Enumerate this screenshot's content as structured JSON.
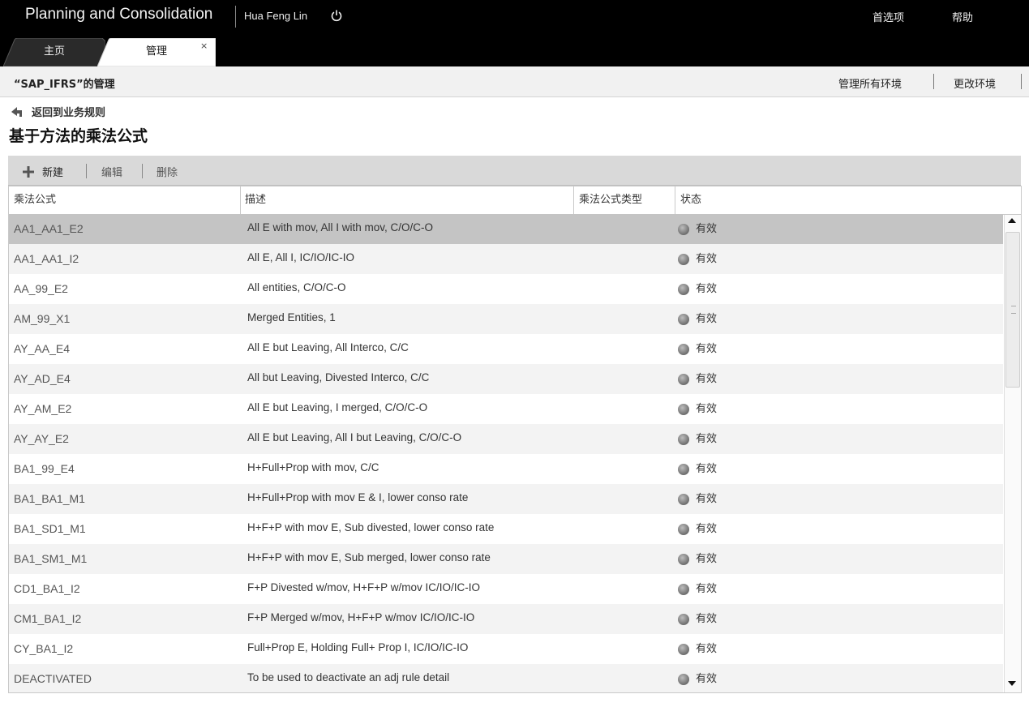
{
  "header": {
    "app_title": "Planning and Consolidation",
    "user_name": "Hua Feng Lin",
    "preferences": "首选项",
    "help": "帮助"
  },
  "tabs": [
    {
      "label": "主页",
      "active": false
    },
    {
      "label": "管理",
      "active": true
    }
  ],
  "tab_close": "×",
  "subheader": {
    "env_title": "“SAP_IFRS”的管理",
    "manage_envs": "管理所有环境",
    "change_env": "更改环境"
  },
  "back_link": "返回到业务规则",
  "page_title": "基于方法的乘法公式",
  "toolbar": {
    "new": "新建",
    "edit": "编辑",
    "delete": "删除"
  },
  "table": {
    "columns": [
      "乘法公式",
      "描述",
      "乘法公式类型",
      "状态"
    ],
    "rows": [
      {
        "name": "AA1_AA1_E2",
        "desc": "All E with mov, All I with mov, C/O/C-O",
        "type": "",
        "status": "有效"
      },
      {
        "name": "AA1_AA1_I2",
        "desc": "All E, All I, IC/IO/IC-IO",
        "type": "",
        "status": "有效"
      },
      {
        "name": "AA_99_E2",
        "desc": "All entities, C/O/C-O",
        "type": "",
        "status": "有效"
      },
      {
        "name": "AM_99_X1",
        "desc": "Merged Entities, 1",
        "type": "",
        "status": "有效"
      },
      {
        "name": "AY_AA_E4",
        "desc": "All E but Leaving, All Interco, C/C",
        "type": "",
        "status": "有效"
      },
      {
        "name": "AY_AD_E4",
        "desc": "All but Leaving, Divested Interco, C/C",
        "type": "",
        "status": "有效"
      },
      {
        "name": "AY_AM_E2",
        "desc": "All E but Leaving,  I merged, C/O/C-O",
        "type": "",
        "status": "有效"
      },
      {
        "name": "AY_AY_E2",
        "desc": "All E but Leaving, All I but Leaving, C/O/C-O",
        "type": "",
        "status": "有效"
      },
      {
        "name": "BA1_99_E4",
        "desc": "H+Full+Prop with mov, C/C",
        "type": "",
        "status": "有效"
      },
      {
        "name": "BA1_BA1_M1",
        "desc": "H+Full+Prop with mov E & I, lower conso rate",
        "type": "",
        "status": "有效"
      },
      {
        "name": "BA1_SD1_M1",
        "desc": "H+F+P with mov E, Sub divested, lower conso rate",
        "type": "",
        "status": "有效"
      },
      {
        "name": "BA1_SM1_M1",
        "desc": "H+F+P with mov E, Sub merged, lower conso rate",
        "type": "",
        "status": "有效"
      },
      {
        "name": "CD1_BA1_I2",
        "desc": "F+P Divested w/mov, H+F+P w/mov IC/IO/IC-IO",
        "type": "",
        "status": "有效"
      },
      {
        "name": "CM1_BA1_I2",
        "desc": "F+P Merged w/mov, H+F+P w/mov IC/IO/IC-IO",
        "type": "",
        "status": "有效"
      },
      {
        "name": "CY_BA1_I2",
        "desc": "Full+Prop E, Holding Full+ Prop I, IC/IO/IC-IO",
        "type": "",
        "status": "有效"
      },
      {
        "name": "DEACTIVATED",
        "desc": "To be used to deactivate an adj rule detail",
        "type": "",
        "status": "有效"
      }
    ]
  },
  "colors": {
    "header_bg": "#000000",
    "selected_row": "#c4c4c4",
    "toolbar_bg": "#d9d9d9"
  }
}
